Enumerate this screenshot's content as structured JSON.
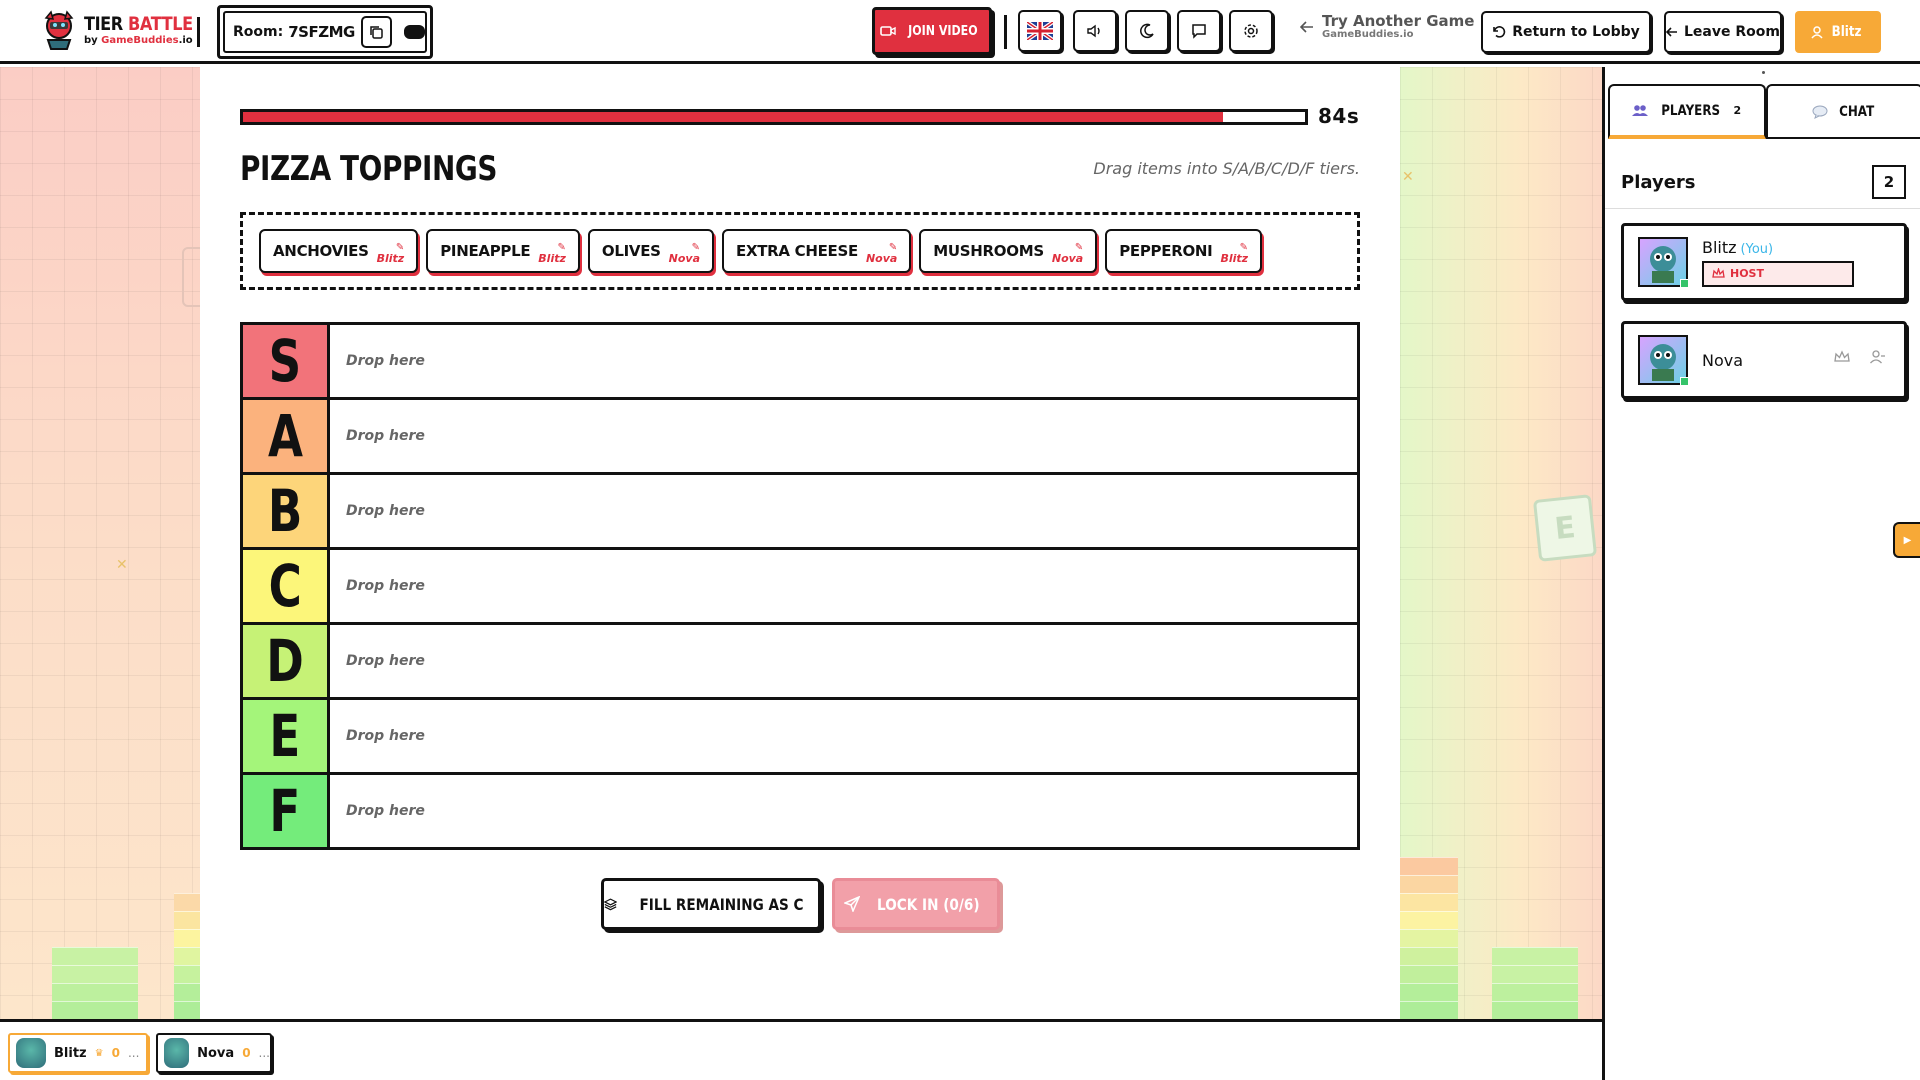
{
  "header": {
    "logo_title_a": "TIER",
    "logo_title_b": "BATTLE",
    "logo_sub_a": "by",
    "logo_sub_b": "GameBuddies",
    "logo_sub_c": ".io",
    "room_label": "Room:",
    "room_code": "7SFZMG",
    "join_video": "JOIN VIDEO",
    "try_title": "Try Another Game",
    "try_sub": "GameBuddies.io",
    "return_lobby": "Return to Lobby",
    "leave_room": "Leave Room",
    "user_name": "Blitz"
  },
  "game": {
    "timer_text": "84s",
    "timer_progress": 0.923,
    "list_title": "PIZZA TOPPINGS",
    "hint": "Drag items into S/A/B/C/D/F tiers.",
    "items": [
      {
        "label": "ANCHOVIES",
        "author": "Blitz"
      },
      {
        "label": "PINEAPPLE",
        "author": "Blitz"
      },
      {
        "label": "OLIVES",
        "author": "Nova"
      },
      {
        "label": "EXTRA CHEESE",
        "author": "Nova"
      },
      {
        "label": "MUSHROOMS",
        "author": "Nova"
      },
      {
        "label": "PEPPERONI",
        "author": "Blitz"
      }
    ],
    "tiers": [
      {
        "label": "S",
        "drop": "Drop here",
        "color": "#f2737a"
      },
      {
        "label": "A",
        "drop": "Drop here",
        "color": "#fbb27d"
      },
      {
        "label": "B",
        "drop": "Drop here",
        "color": "#fdd57a"
      },
      {
        "label": "C",
        "drop": "Drop here",
        "color": "#fcf67a"
      },
      {
        "label": "D",
        "drop": "Drop here",
        "color": "#c6f276"
      },
      {
        "label": "E",
        "drop": "Drop here",
        "color": "#a4f57a"
      },
      {
        "label": "F",
        "drop": "Drop here",
        "color": "#74ec7b"
      }
    ],
    "fill_button": "FILL REMAINING AS C",
    "lock_button": "LOCK IN (0/6)"
  },
  "panel": {
    "tab_players": "PLAYERS",
    "tab_players_count": "2",
    "tab_chat": "CHAT",
    "title": "Players",
    "count": "2",
    "players": [
      {
        "name": "Blitz",
        "you": "(You)",
        "badge": "HOST"
      },
      {
        "name": "Nova"
      }
    ]
  },
  "bottom": {
    "players": [
      {
        "name": "Blitz",
        "score": "0",
        "more": "..."
      },
      {
        "name": "Nova",
        "score": "0",
        "more": "..."
      }
    ]
  },
  "colors": {
    "accent_red": "#e0303f",
    "accent_orange": "#f7a937",
    "lock_disabled": "#f2a0a9"
  }
}
